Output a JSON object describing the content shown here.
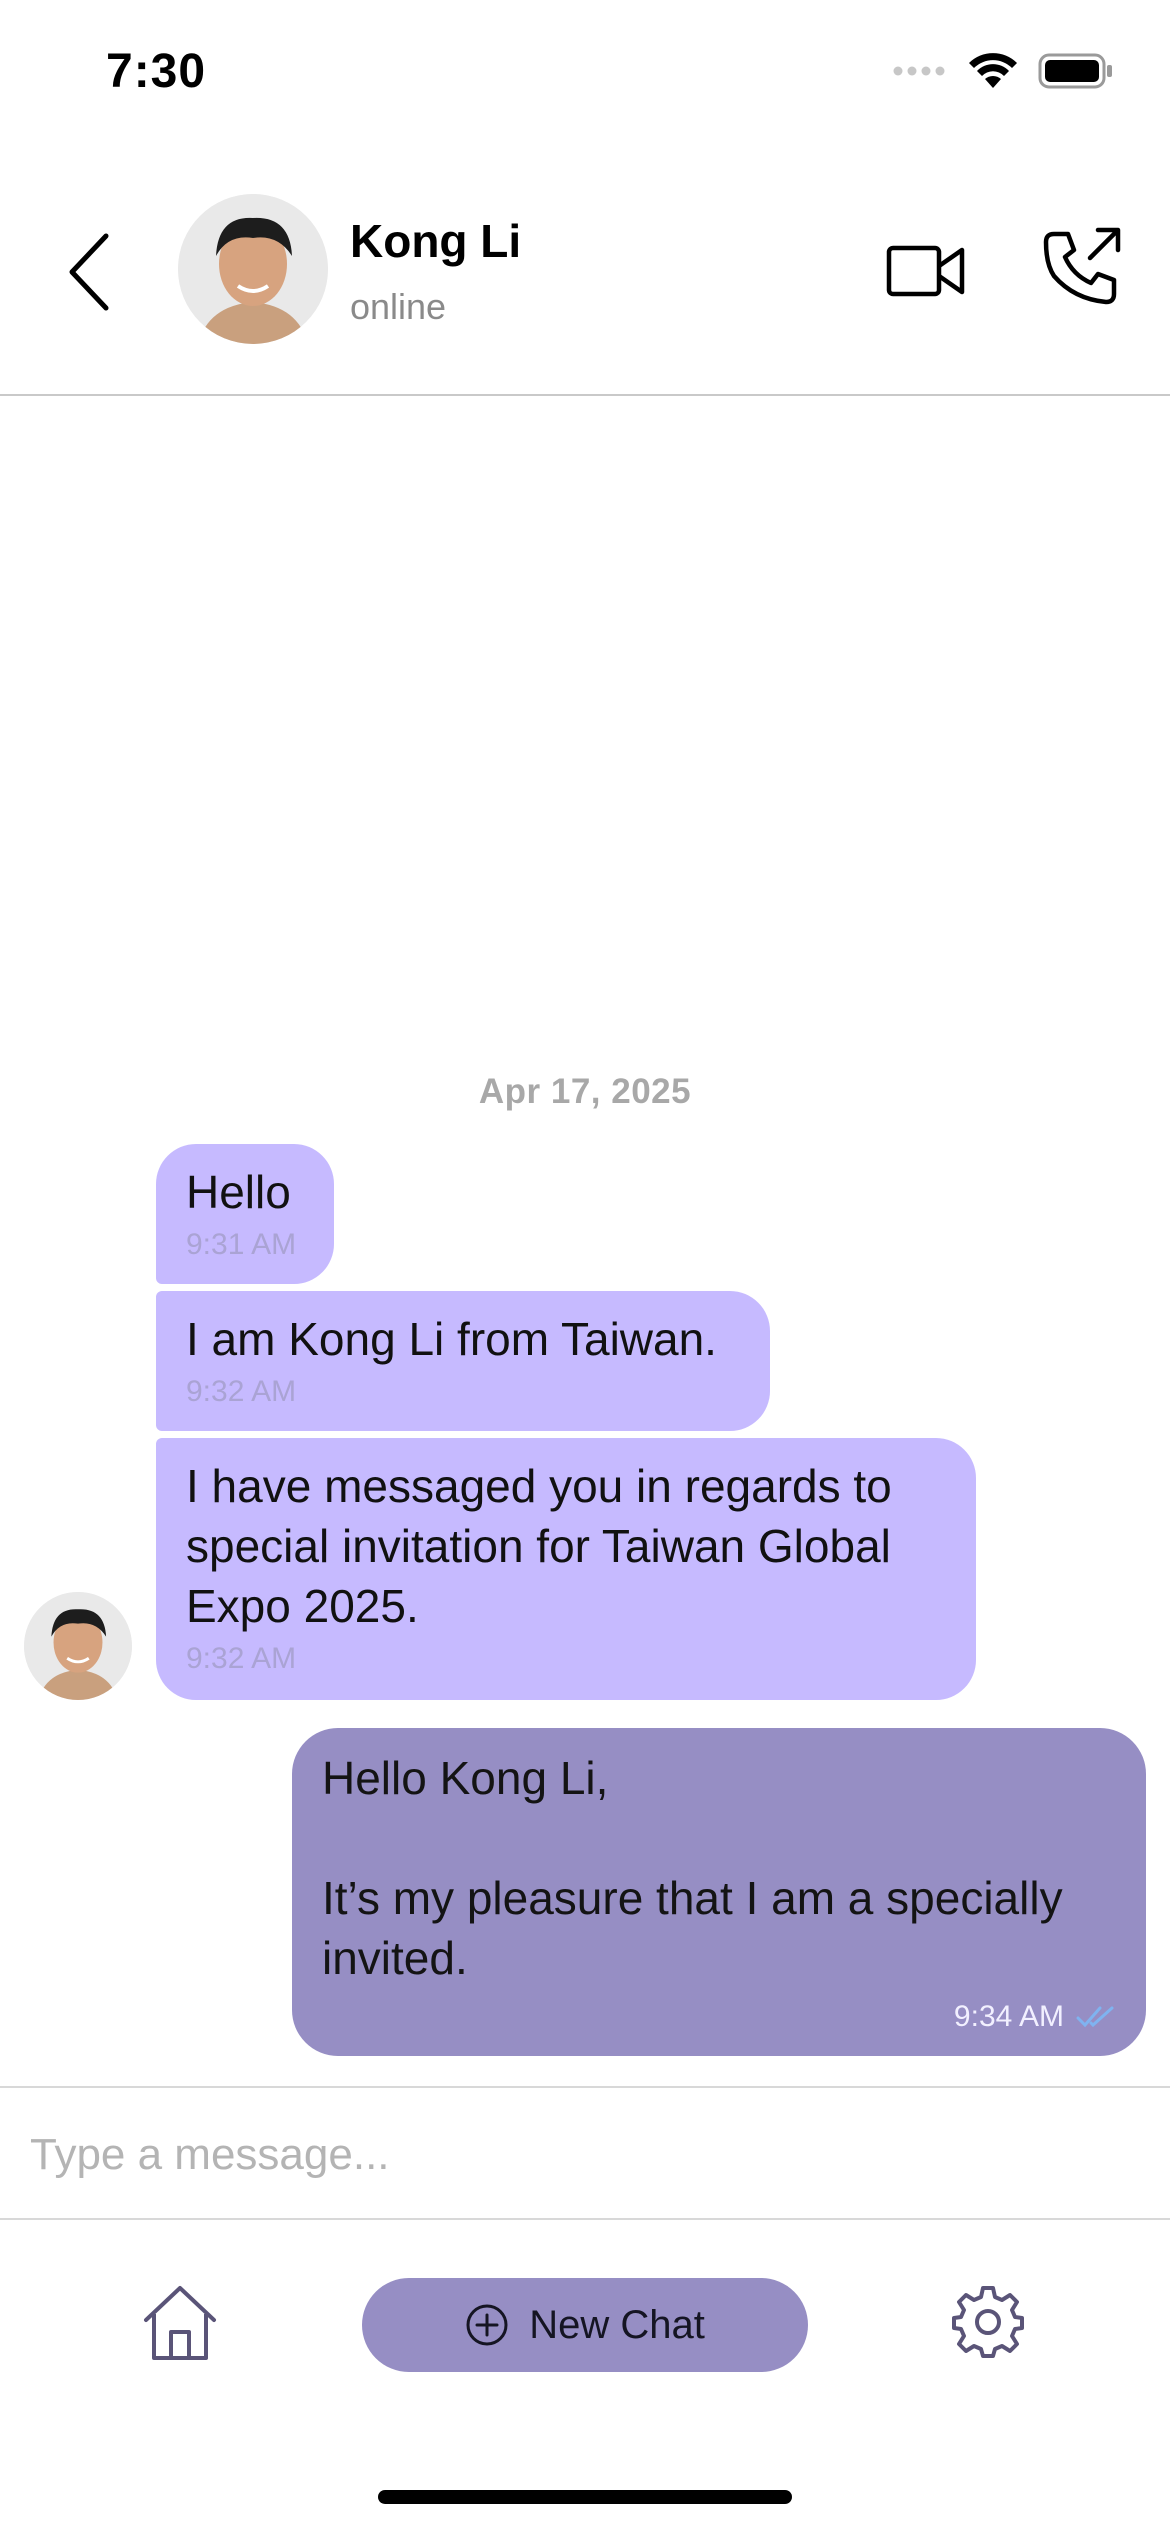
{
  "status_bar": {
    "time": "7:30",
    "icons": [
      "signal-icon",
      "wifi-icon",
      "battery-icon"
    ]
  },
  "header": {
    "back_icon": "chevron-left-icon",
    "contact_name": "Kong Li",
    "contact_status": "online",
    "video_icon": "video-camera-icon",
    "call_icon": "outgoing-call-icon"
  },
  "chat": {
    "date_separator": "Apr 17, 2025",
    "messages": [
      {
        "direction": "incoming",
        "text": "Hello",
        "time": "9:31 AM"
      },
      {
        "direction": "incoming",
        "text": "I am Kong Li from Taiwan.",
        "time": "9:32 AM"
      },
      {
        "direction": "incoming",
        "text": "I have messaged you in regards to special invitation for Taiwan Global Expo 2025.",
        "time": "9:32 AM"
      },
      {
        "direction": "outgoing",
        "text": "Hello Kong Li,\n\nIt’s my pleasure that I am a specially invited.",
        "time": "9:34 AM",
        "status_icon": "double-check-icon"
      }
    ]
  },
  "composer": {
    "placeholder": "Type a message..."
  },
  "bottom_bar": {
    "home_icon": "home-icon",
    "new_chat_label": "New Chat",
    "new_chat_icon": "plus-circle-icon",
    "settings_icon": "gear-icon"
  },
  "colors": {
    "incoming_bubble": "#c6baff",
    "outgoing_bubble": "#968ec4",
    "accent": "#968ec4",
    "read_check": "#7fb3f0"
  }
}
